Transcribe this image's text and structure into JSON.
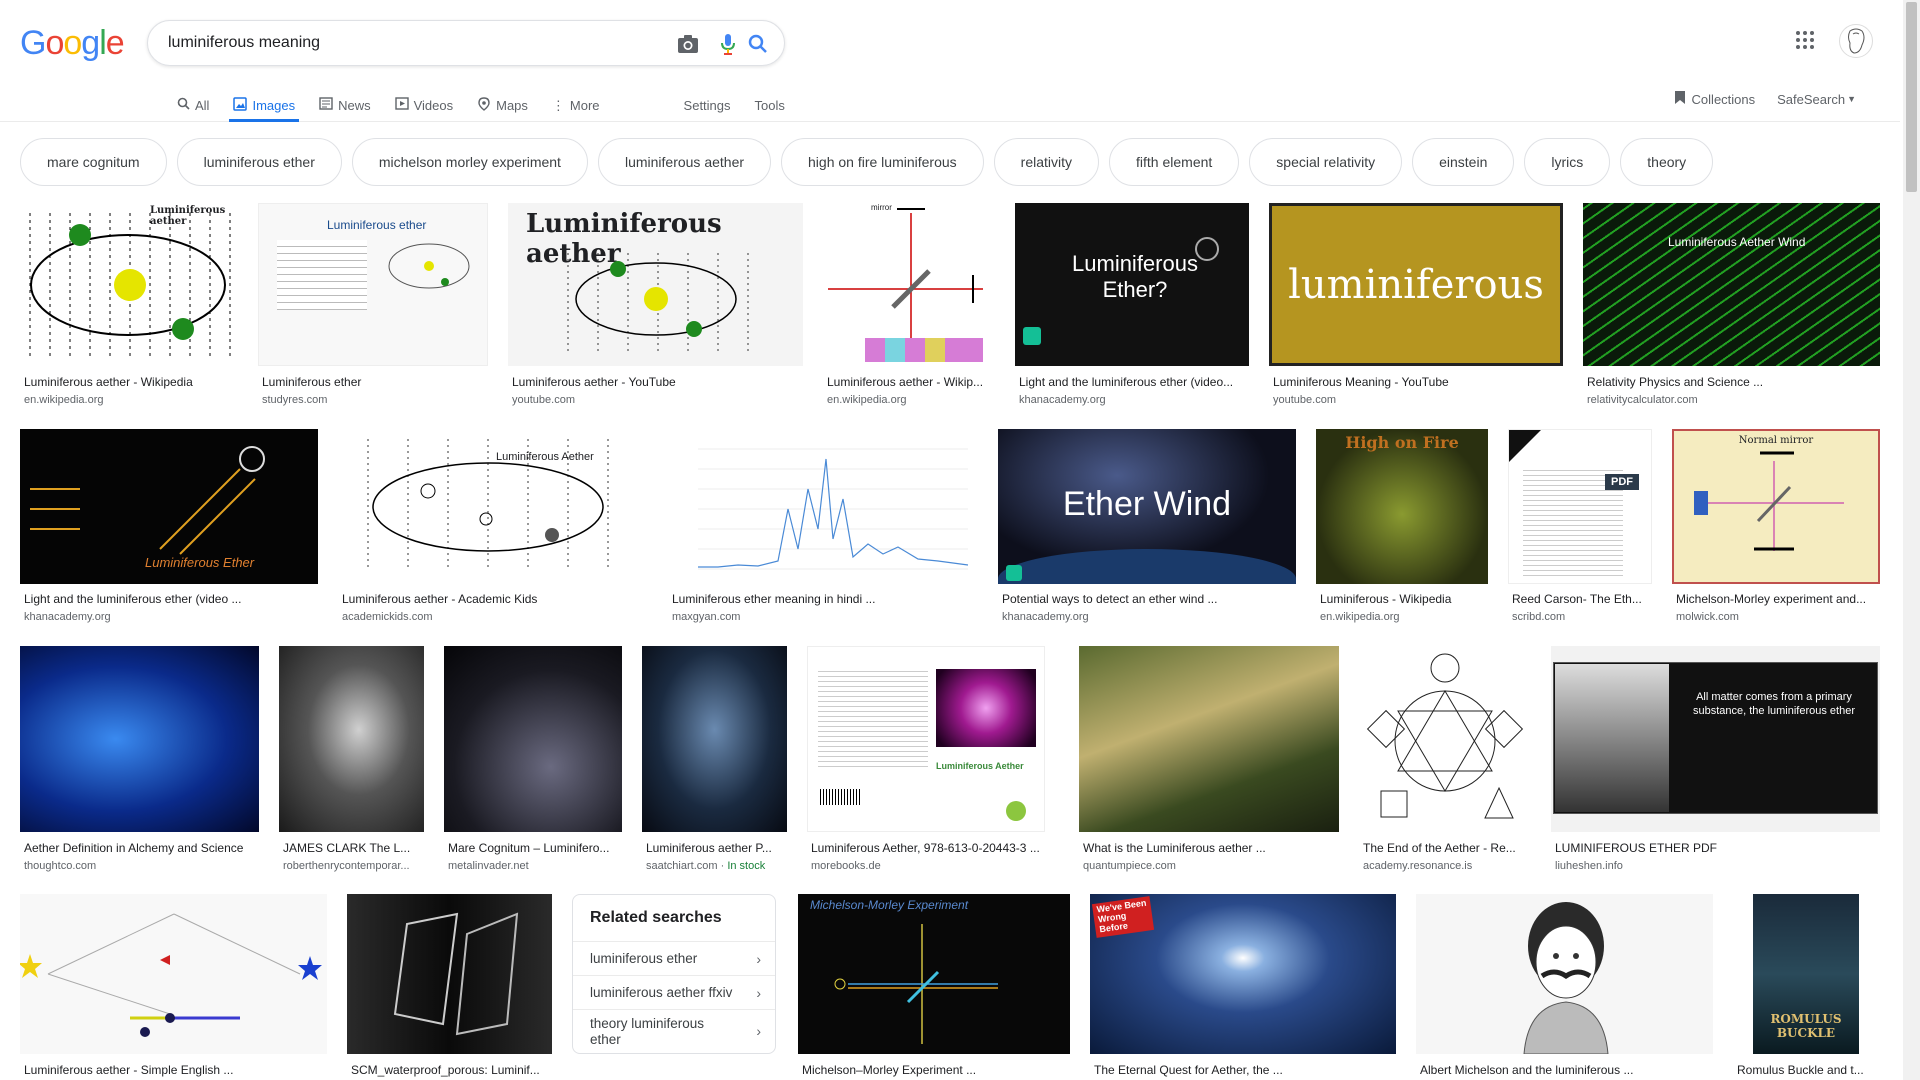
{
  "search": {
    "query": "luminiferous meaning"
  },
  "logo": {
    "text": "Google",
    "colors": [
      "#4285F4",
      "#EA4335",
      "#FBBC05",
      "#4285F4",
      "#34A853",
      "#EA4335"
    ]
  },
  "tabs": [
    {
      "label": "All",
      "icon": "search-icon"
    },
    {
      "label": "Images",
      "icon": "image-icon"
    },
    {
      "label": "News",
      "icon": "news-icon"
    },
    {
      "label": "Videos",
      "icon": "video-icon"
    },
    {
      "label": "Maps",
      "icon": "map-icon"
    },
    {
      "label": "More",
      "icon": "more-vert-icon"
    }
  ],
  "tools": {
    "settings": "Settings",
    "tools": "Tools",
    "collections": "Collections",
    "safesearch": "SafeSearch"
  },
  "chips": [
    "mare cognitum",
    "luminiferous ether",
    "michelson morley experiment",
    "luminiferous aether",
    "high on fire luminiferous",
    "relativity",
    "fifth element",
    "special relativity",
    "einstein",
    "lyrics",
    "theory"
  ],
  "results": {
    "row1": [
      {
        "title": "Luminiferous aether - Wikipedia",
        "source": "en.wikipedia.org",
        "thumb_text": "Luminiferous aether"
      },
      {
        "title": "Luminiferous ether",
        "source": "studyres.com",
        "thumb_text": "Luminiferous ether"
      },
      {
        "title": "Luminiferous aether - YouTube",
        "source": "youtube.com",
        "thumb_text": "Luminiferous aether"
      },
      {
        "title": "Luminiferous aether - Wikip...",
        "source": "en.wikipedia.org",
        "thumb_text": "mirror"
      },
      {
        "title": "Light and the luminiferous ether (video...",
        "source": "khanacademy.org",
        "thumb_text": "Luminiferous Ether?"
      },
      {
        "title": "Luminiferous Meaning - YouTube",
        "source": "youtube.com",
        "thumb_text": "luminiferous"
      },
      {
        "title": "Relativity Physics and Science ...",
        "source": "relativitycalculator.com",
        "thumb_text": "Luminiferous Aether Wind"
      }
    ],
    "row2": [
      {
        "title": "Light and the luminiferous ether (video ...",
        "source": "khanacademy.org",
        "thumb_text": "Luminiferous Ether"
      },
      {
        "title": "Luminiferous aether - Academic Kids",
        "source": "academickids.com",
        "thumb_text": "Luminiferous Aether"
      },
      {
        "title": "Luminiferous ether meaning in hindi ...",
        "source": "maxgyan.com",
        "thumb_text": ""
      },
      {
        "title": "Potential ways to detect an ether wind ...",
        "source": "khanacademy.org",
        "thumb_text": "Ether Wind"
      },
      {
        "title": "Luminiferous - Wikipedia",
        "source": "en.wikipedia.org",
        "thumb_text": "High on Fire"
      },
      {
        "title": "Reed Carson- The Eth...",
        "source": "scribd.com",
        "thumb_text": "PDF"
      },
      {
        "title": "Michelson-Morley experiment and...",
        "source": "molwick.com",
        "thumb_text": "Normal mirror"
      }
    ],
    "row3": [
      {
        "title": "Aether Definition in Alchemy and Science",
        "source": "thoughtco.com",
        "thumb_text": ""
      },
      {
        "title": "JAMES CLARK The L...",
        "source": "roberthenrycontemporar...",
        "thumb_text": ""
      },
      {
        "title": "Mare Cognitum – Luminifero...",
        "source": "metalinvader.net",
        "thumb_text": ""
      },
      {
        "title": "Luminiferous aether P...",
        "source": "saatchiart.com",
        "source_extra": "In stock",
        "thumb_text": ""
      },
      {
        "title": "Luminiferous Aether, 978-613-0-20443-3 ...",
        "source": "morebooks.de",
        "thumb_text": "Luminiferous Aether"
      },
      {
        "title": "What is the Luminiferous aether ...",
        "source": "quantumpiece.com",
        "thumb_text": ""
      },
      {
        "title": "The End of the Aether - Re...",
        "source": "academy.resonance.is",
        "thumb_text": ""
      },
      {
        "title": "LUMINIFEROUS ETHER PDF",
        "source": "liuheshen.info",
        "thumb_text": "All matter comes from a primary substance, the luminiferous ether"
      }
    ],
    "row4": [
      {
        "title": "Luminiferous aether - Simple English ...",
        "thumb_text": ""
      },
      {
        "title": "SCM_waterproof_porous: Luminif...",
        "thumb_text": ""
      },
      {
        "title": "Michelson–Morley Experiment ...",
        "thumb_text": "Michelson-Morley Experiment"
      },
      {
        "title": "The Eternal Quest for Aether, the ...",
        "thumb_text": "We've Been Wrong Before"
      },
      {
        "title": "Albert Michelson and the luminiferous ...",
        "thumb_text": ""
      },
      {
        "title": "Romulus Buckle and t...",
        "thumb_text": "ROMULUS BUCKLE"
      }
    ]
  },
  "related": {
    "title": "Related searches",
    "items": [
      "luminiferous ether",
      "luminiferous aether ffxiv",
      "theory luminiferous ether"
    ]
  }
}
